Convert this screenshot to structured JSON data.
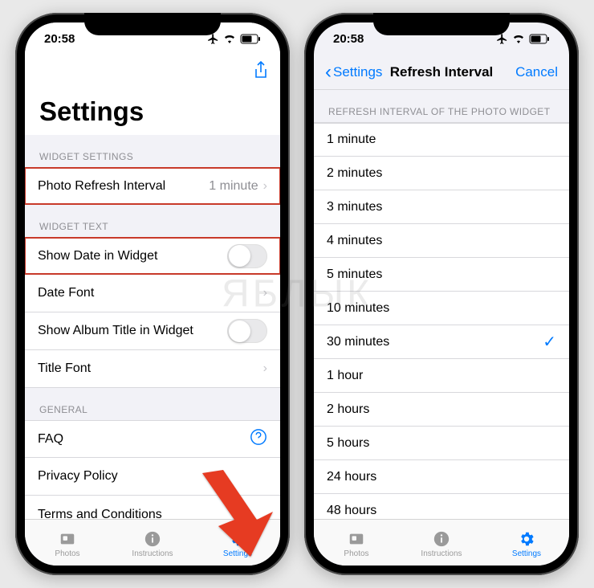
{
  "statusbar": {
    "time": "20:58"
  },
  "left": {
    "share": "Share",
    "title": "Settings",
    "section_widget_settings": "WIDGET SETTINGS",
    "row_refresh": {
      "label": "Photo Refresh Interval",
      "value": "1 minute"
    },
    "section_widget_text": "WIDGET TEXT",
    "row_showdate": "Show Date in Widget",
    "row_datefont": "Date Font",
    "row_showalbum": "Show Album Title in Widget",
    "row_titlefont": "Title Font",
    "section_general": "GENERAL",
    "row_faq": "FAQ",
    "row_privacy": "Privacy Policy",
    "row_terms": "Terms and Conditions"
  },
  "right": {
    "back": "Settings",
    "title": "Refresh Interval",
    "cancel": "Cancel",
    "section": "REFRESH INTERVAL OF THE PHOTO WIDGET",
    "options": [
      "1 minute",
      "2 minutes",
      "3 minutes",
      "4 minutes",
      "5 minutes",
      "10 minutes",
      "30 minutes",
      "1 hour",
      "2 hours",
      "5 hours",
      "24 hours",
      "48 hours"
    ],
    "selected": "30 minutes"
  },
  "tabs": {
    "photos": "Photos",
    "instructions": "Instructions",
    "settings": "Settings"
  },
  "watermark": "ЯБЛЫК"
}
